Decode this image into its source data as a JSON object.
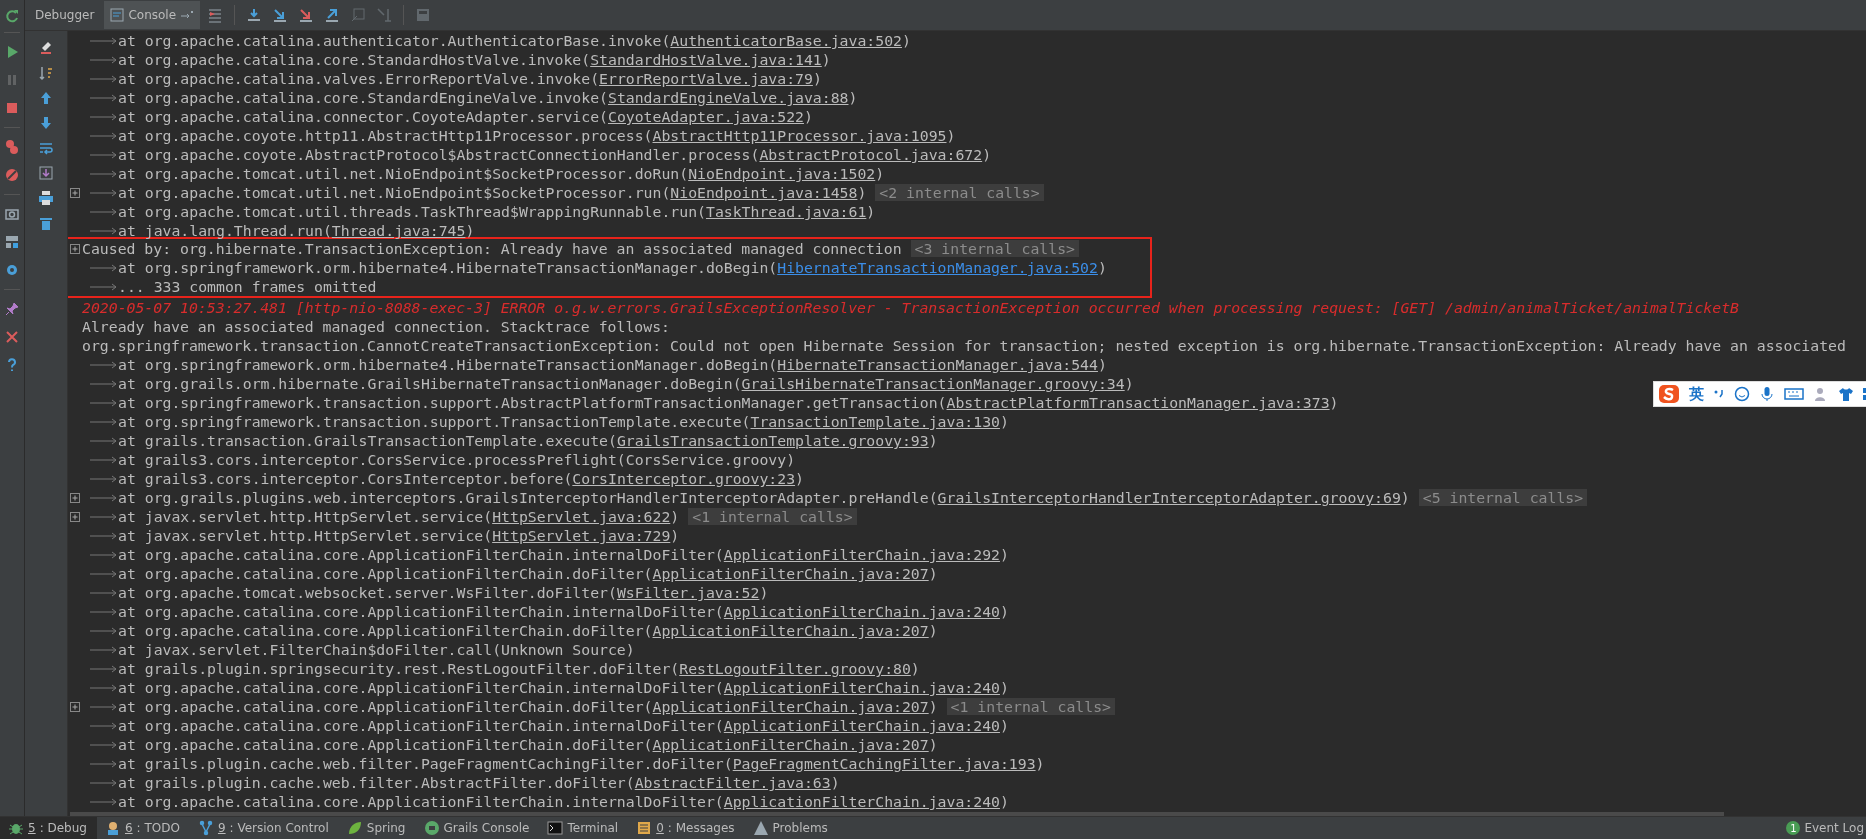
{
  "toolbar": {
    "tabs": [
      {
        "label": "Debugger",
        "selected": false
      },
      {
        "label": "Console",
        "selected": true
      }
    ],
    "buttons": [
      {
        "kind": "execution-point",
        "disabled": false
      },
      {
        "kind": "step-over",
        "disabled": false
      },
      {
        "kind": "step-into",
        "disabled": false
      },
      {
        "kind": "force-step-into",
        "disabled": false
      },
      {
        "kind": "step-out",
        "disabled": false
      },
      {
        "kind": "drop-frame",
        "disabled": true
      },
      {
        "kind": "run-to-cursor",
        "disabled": true
      },
      {
        "kind": "evaluate",
        "disabled": true
      }
    ]
  },
  "debug_actions": [
    {
      "kind": "resume",
      "disabled": false
    },
    {
      "kind": "pause",
      "disabled": true
    },
    {
      "kind": "stop",
      "disabled": false
    },
    {
      "kind": "breakpoints",
      "disabled": false
    },
    {
      "kind": "mute",
      "disabled": false
    },
    {
      "kind": "camera",
      "disabled": false
    },
    {
      "kind": "layout",
      "disabled": false
    },
    {
      "kind": "settings",
      "disabled": false
    },
    {
      "kind": "pin",
      "disabled": false
    },
    {
      "kind": "close",
      "disabled": false
    },
    {
      "kind": "help",
      "disabled": false
    }
  ],
  "console_actions": [
    {
      "kind": "clear"
    },
    {
      "kind": "sort"
    },
    {
      "kind": "up"
    },
    {
      "kind": "down"
    },
    {
      "kind": "wrap"
    },
    {
      "kind": "scroll-end"
    },
    {
      "kind": "print"
    },
    {
      "kind": "trash"
    }
  ],
  "lines": [
    {
      "kind": "frame",
      "text": "at org.apache.catalina.authenticator.AuthenticatorBase.invoke(",
      "link": "AuthenticatorBase.java:502",
      "tail": ")"
    },
    {
      "kind": "frame",
      "text": "at org.apache.catalina.core.StandardHostValve.invoke(",
      "link": "StandardHostValve.java:141",
      "tail": ")"
    },
    {
      "kind": "frame",
      "text": "at org.apache.catalina.valves.ErrorReportValve.invoke(",
      "link": "ErrorReportValve.java:79",
      "tail": ")"
    },
    {
      "kind": "frame",
      "text": "at org.apache.catalina.core.StandardEngineValve.invoke(",
      "link": "StandardEngineValve.java:88",
      "tail": ")"
    },
    {
      "kind": "frame",
      "text": "at org.apache.catalina.connector.CoyoteAdapter.service(",
      "link": "CoyoteAdapter.java:522",
      "tail": ")"
    },
    {
      "kind": "frame",
      "text": "at org.apache.coyote.http11.AbstractHttp11Processor.process(",
      "link": "AbstractHttp11Processor.java:1095",
      "tail": ")"
    },
    {
      "kind": "frame",
      "text": "at org.apache.coyote.AbstractProtocol$AbstractConnectionHandler.process(",
      "link": "AbstractProtocol.java:672",
      "tail": ")"
    },
    {
      "kind": "frame",
      "text": "at org.apache.tomcat.util.net.NioEndpoint$SocketProcessor.doRun(",
      "link": "NioEndpoint.java:1502",
      "tail": ")"
    },
    {
      "kind": "frame",
      "text": "at org.apache.tomcat.util.net.NioEndpoint$SocketProcessor.run(",
      "link": "NioEndpoint.java:1458",
      "tail": ")",
      "fold": true,
      "internal": "<2 internal calls>"
    },
    {
      "kind": "frame",
      "text": "at org.apache.tomcat.util.threads.TaskThread$WrappingRunnable.run(",
      "link": "TaskThread.java:61",
      "tail": ")"
    },
    {
      "kind": "frame",
      "text": "at java.lang.Thread.run(",
      "link": "Thread.java:745",
      "tail": ")"
    },
    {
      "kind": "caused",
      "text": "Caused by: org.hibernate.TransactionException: Already have an associated managed connection",
      "fold": true,
      "internal": "<3 internal calls>",
      "boxed": true
    },
    {
      "kind": "frame",
      "text": "at org.springframework.orm.hibernate4.HibernateTransactionManager.doBegin(",
      "link": "HibernateTransactionManager.java:502",
      "tail": ")",
      "boxed": true,
      "link_active": true
    },
    {
      "kind": "frame",
      "text": "... 333 common frames omitted",
      "boxed": true
    },
    {
      "kind": "error",
      "text": "2020-05-07 10:53:27.481 [http-nio-8088-exec-3] ERROR o.g.w.errors.GrailsExceptionResolver - TransactionException occurred when processing request: [GET] /admin/animalTicket/animalTicketB"
    },
    {
      "kind": "plain",
      "text": "Already have an associated managed connection. Stacktrace follows:"
    },
    {
      "kind": "plain",
      "text": "org.springframework.transaction.CannotCreateTransactionException: Could not open Hibernate Session for transaction; nested exception is org.hibernate.TransactionException: Already have an associated"
    },
    {
      "kind": "frame",
      "text": "at org.springframework.orm.hibernate4.HibernateTransactionManager.doBegin(",
      "link": "HibernateTransactionManager.java:544",
      "tail": ")"
    },
    {
      "kind": "frame",
      "text": "at org.grails.orm.hibernate.GrailsHibernateTransactionManager.doBegin(",
      "link": "GrailsHibernateTransactionManager.groovy:34",
      "tail": ")"
    },
    {
      "kind": "frame",
      "text": "at org.springframework.transaction.support.AbstractPlatformTransactionManager.getTransaction(",
      "link": "AbstractPlatformTransactionManager.java:373",
      "tail": ")"
    },
    {
      "kind": "frame",
      "text": "at org.springframework.transaction.support.TransactionTemplate.execute(",
      "link": "TransactionTemplate.java:130",
      "tail": ")"
    },
    {
      "kind": "frame",
      "text": "at grails.transaction.GrailsTransactionTemplate.execute(",
      "link": "GrailsTransactionTemplate.groovy:93",
      "tail": ")"
    },
    {
      "kind": "frame",
      "text": "at grails3.cors.interceptor.CorsService.processPreflight(CorsService.groovy)"
    },
    {
      "kind": "frame",
      "text": "at grails3.cors.interceptor.CorsInterceptor.before(",
      "link": "CorsInterceptor.groovy:23",
      "tail": ")"
    },
    {
      "kind": "frame",
      "text": "at org.grails.plugins.web.interceptors.GrailsInterceptorHandlerInterceptorAdapter.preHandle(",
      "link": "GrailsInterceptorHandlerInterceptorAdapter.groovy:69",
      "tail": ")",
      "fold": true,
      "internal": "<5 internal calls>"
    },
    {
      "kind": "frame",
      "text": "at javax.servlet.http.HttpServlet.service(",
      "link": "HttpServlet.java:622",
      "tail": ")",
      "fold": true,
      "internal": "<1 internal calls>"
    },
    {
      "kind": "frame",
      "text": "at javax.servlet.http.HttpServlet.service(",
      "link": "HttpServlet.java:729",
      "tail": ")"
    },
    {
      "kind": "frame",
      "text": "at org.apache.catalina.core.ApplicationFilterChain.internalDoFilter(",
      "link": "ApplicationFilterChain.java:292",
      "tail": ")"
    },
    {
      "kind": "frame",
      "text": "at org.apache.catalina.core.ApplicationFilterChain.doFilter(",
      "link": "ApplicationFilterChain.java:207",
      "tail": ")"
    },
    {
      "kind": "frame",
      "text": "at org.apache.tomcat.websocket.server.WsFilter.doFilter(",
      "link": "WsFilter.java:52",
      "tail": ")"
    },
    {
      "kind": "frame",
      "text": "at org.apache.catalina.core.ApplicationFilterChain.internalDoFilter(",
      "link": "ApplicationFilterChain.java:240",
      "tail": ")"
    },
    {
      "kind": "frame",
      "text": "at org.apache.catalina.core.ApplicationFilterChain.doFilter(",
      "link": "ApplicationFilterChain.java:207",
      "tail": ")"
    },
    {
      "kind": "frame",
      "text": "at javax.servlet.FilterChain$doFilter.call(Unknown Source)"
    },
    {
      "kind": "frame",
      "text": "at grails.plugin.springsecurity.rest.RestLogoutFilter.doFilter(",
      "link": "RestLogoutFilter.groovy:80",
      "tail": ")"
    },
    {
      "kind": "frame",
      "text": "at org.apache.catalina.core.ApplicationFilterChain.internalDoFilter(",
      "link": "ApplicationFilterChain.java:240",
      "tail": ")"
    },
    {
      "kind": "frame",
      "text": "at org.apache.catalina.core.ApplicationFilterChain.doFilter(",
      "link": "ApplicationFilterChain.java:207",
      "tail": ")",
      "fold": true,
      "internal": "<1 internal calls>"
    },
    {
      "kind": "frame",
      "text": "at org.apache.catalina.core.ApplicationFilterChain.internalDoFilter(",
      "link": "ApplicationFilterChain.java:240",
      "tail": ")"
    },
    {
      "kind": "frame",
      "text": "at org.apache.catalina.core.ApplicationFilterChain.doFilter(",
      "link": "ApplicationFilterChain.java:207",
      "tail": ")"
    },
    {
      "kind": "frame",
      "text": "at grails.plugin.cache.web.filter.PageFragmentCachingFilter.doFilter(",
      "link": "PageFragmentCachingFilter.java:193",
      "tail": ")"
    },
    {
      "kind": "frame",
      "text": "at grails.plugin.cache.web.filter.AbstractFilter.doFilter(",
      "link": "AbstractFilter.java:63",
      "tail": ")"
    },
    {
      "kind": "frame",
      "text": "at org.apache.catalina.core.ApplicationFilterChain.internalDoFilter(",
      "link": "ApplicationFilterChain.java:240",
      "tail": ")"
    }
  ],
  "ime_bar": {
    "mode": "英"
  },
  "status_bar": {
    "tools": [
      {
        "kind": "debug",
        "mnemonic": "5",
        "label": ": Debug",
        "selected": true
      },
      {
        "kind": "todo",
        "mnemonic": "6",
        "label": ": TODO",
        "selected": false
      },
      {
        "kind": "vcs",
        "mnemonic": "9",
        "label": ": Version Control",
        "selected": false
      },
      {
        "kind": "spring",
        "label": "Spring",
        "selected": false
      },
      {
        "kind": "grails",
        "label": "Grails Console",
        "selected": false
      },
      {
        "kind": "terminal",
        "label": "Terminal",
        "selected": false
      },
      {
        "kind": "messages",
        "mnemonic": "0",
        "label": ": Messages",
        "selected": false
      },
      {
        "kind": "problems",
        "label": "Problems",
        "selected": false
      }
    ],
    "event_log": {
      "count": "1",
      "label": "Event Log"
    }
  }
}
